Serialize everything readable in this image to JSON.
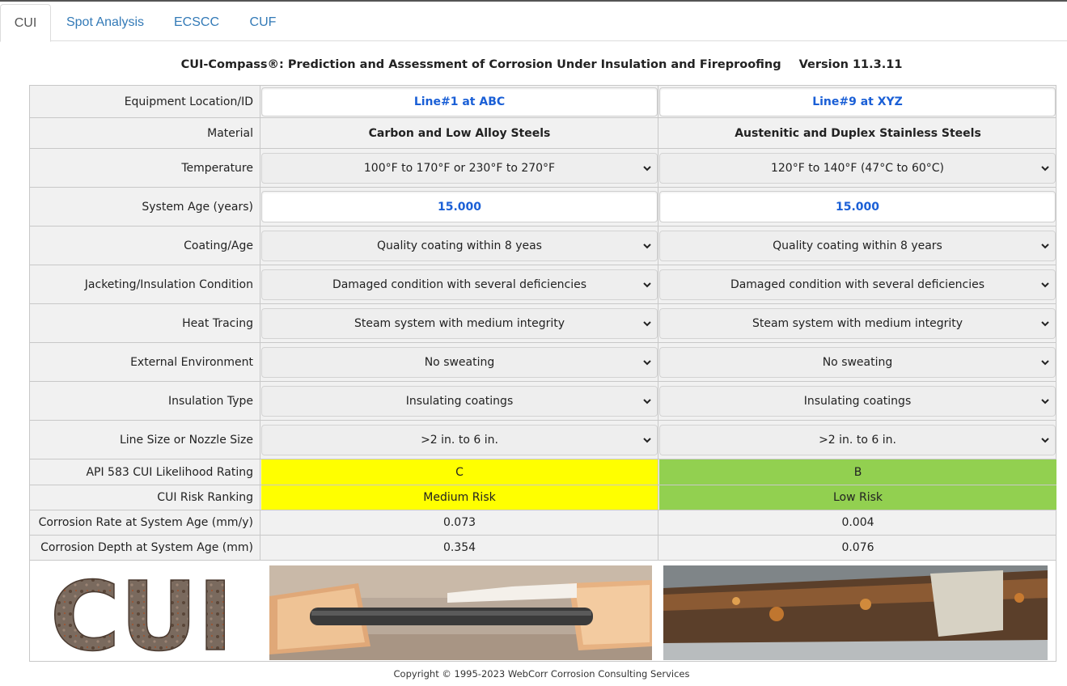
{
  "tabs": [
    {
      "label": "CUI",
      "active": true
    },
    {
      "label": "Spot Analysis",
      "active": false
    },
    {
      "label": "ECSCC",
      "active": false
    },
    {
      "label": "CUF",
      "active": false
    }
  ],
  "header": {
    "title": "CUI-Compass®: Prediction and Assessment of Corrosion Under Insulation and Fireproofing",
    "version": "Version 11.3.11"
  },
  "rows": {
    "location": {
      "label": "Equipment Location/ID",
      "col1": "Line#1 at ABC",
      "col2": "Line#9 at XYZ"
    },
    "material": {
      "label": "Material",
      "col1": "Carbon and Low Alloy Steels",
      "col2": "Austenitic and Duplex Stainless Steels"
    },
    "temperature": {
      "label": "Temperature",
      "col1": "100°F to 170°F or 230°F to 270°F",
      "col2": "120°F to 140°F (47°C to 60°C)"
    },
    "age": {
      "label": "System Age (years)",
      "col1": "15.000",
      "col2": "15.000"
    },
    "coating": {
      "label": "Coating/Age",
      "col1": "Quality coating within 8 yeas",
      "col2": "Quality coating within 8 years"
    },
    "jacketing": {
      "label": "Jacketing/Insulation Condition",
      "col1": "Damaged condition with several deficiencies",
      "col2": "Damaged condition with several deficiencies"
    },
    "heat_tracing": {
      "label": "Heat Tracing",
      "col1": "Steam system with medium integrity",
      "col2": "Steam system with medium integrity"
    },
    "environment": {
      "label": "External Environment",
      "col1": "No sweating",
      "col2": "No sweating"
    },
    "insulation": {
      "label": "Insulation Type",
      "col1": "Insulating coatings",
      "col2": "Insulating coatings"
    },
    "line_size": {
      "label": "Line Size or Nozzle Size",
      "col1": ">2 in. to 6 in.",
      "col2": ">2 in. to 6 in."
    },
    "likelihood": {
      "label": "API 583 CUI Likelihood Rating",
      "col1": "C",
      "col2": "B"
    },
    "risk": {
      "label": "CUI Risk Ranking",
      "col1": "Medium Risk",
      "col2": "Low Risk"
    },
    "rate": {
      "label": "Corrosion Rate at System Age (mm/y)",
      "col1": "0.073",
      "col2": "0.004"
    },
    "depth": {
      "label": "Corrosion Depth at System Age (mm)",
      "col1": "0.354",
      "col2": "0.076"
    }
  },
  "images": {
    "logo_text": "CUI"
  },
  "colors": {
    "yellow": "#ffff00",
    "green": "#92d050",
    "link": "#1a5fd6"
  },
  "footer": {
    "copyright": "Copyright © 1995-2023 WebCorr Corrosion Consulting Services"
  }
}
